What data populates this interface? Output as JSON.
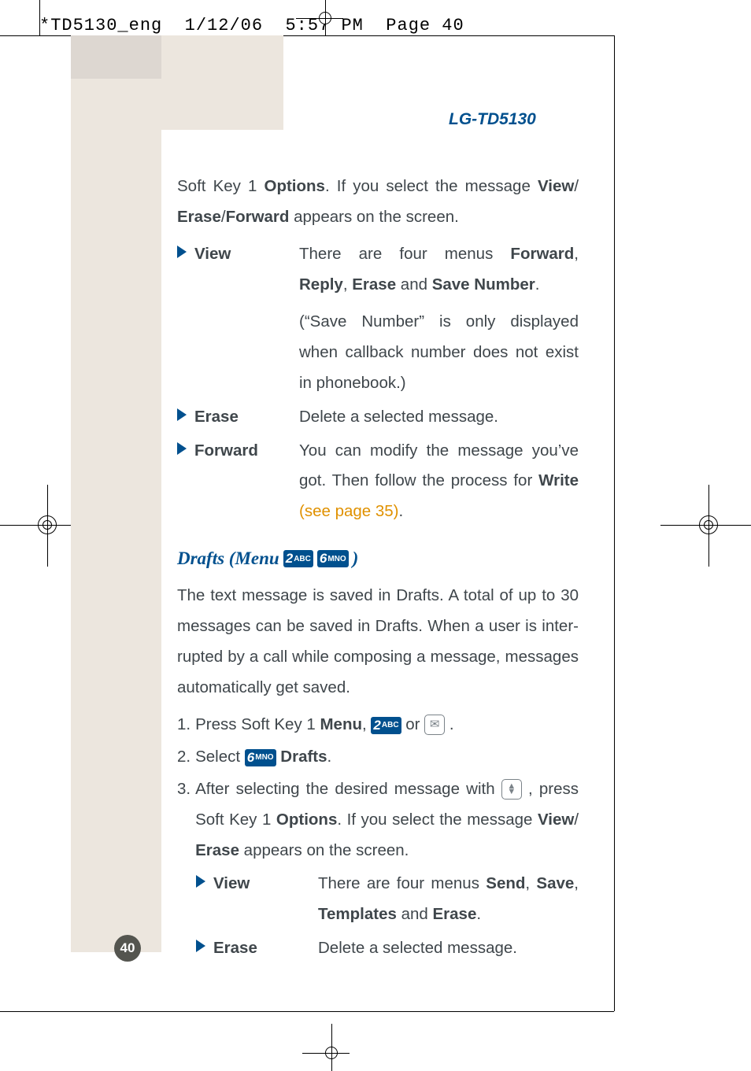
{
  "header": {
    "filename": "*TD5130_eng",
    "date": "1/12/06",
    "time": "5:57 PM",
    "pageLabel": "Page 40"
  },
  "model": "LG-TD5130",
  "intro": {
    "pre": "Soft Key 1 ",
    "options": "Options",
    "mid1": ". If you select the message ",
    "view": "View",
    "slash1": "/",
    "erase": "Erase",
    "slash2": "/",
    "forward": "Forward",
    "post": " appears on the screen."
  },
  "list1": {
    "view": {
      "term": "View",
      "def_pre": "There are four menus ",
      "m1": "Forward",
      "sep1": ", ",
      "m2": "Reply",
      "sep2": ", ",
      "m3": "Erase",
      "sep3": " and ",
      "m4": "Save Number",
      "period": ".",
      "note": "(“Save Number” is only displayed when callback number does not exist in phonebook.)"
    },
    "erase": {
      "term": "Erase",
      "def": "Delete a selected message."
    },
    "forward": {
      "term": "Forward",
      "def_pre": "You can modify the message you’ve got. Then follow the process for ",
      "write": "Write",
      "space": " ",
      "link": "(see page 35)",
      "period": "."
    }
  },
  "section": {
    "title_pre": "Drafts (Menu ",
    "key1_digit": "2",
    "key1_sub": "ABC",
    "key2_digit": "6",
    "key2_sub": "MNO",
    "title_post": " )"
  },
  "drafts_intro": "The text message is saved in Drafts. A total of up to 30 messages can be saved in Drafts.  When a user is inter- rupted by a call while composing a message, messages automatically get saved.",
  "steps": {
    "s1_num": "1.",
    "s1_pre": " Press Soft Key 1 ",
    "s1_menu": "Menu",
    "s1_mid": ", ",
    "s1_key_digit": "2",
    "s1_key_sub": "ABC",
    "s1_or": " or ",
    "s1_end": " .",
    "s2_num": "2.",
    "s2_pre": " Select ",
    "s2_key_digit": "6",
    "s2_key_sub": "MNO",
    "s2_drafts": " Drafts",
    "s2_period": ".",
    "s3_num": "3.",
    "s3_pre": " After selecting the desired message with ",
    "s3_mid": " , press Soft Key 1 ",
    "s3_options": "Options",
    "s3_post": ". If you select the message ",
    "s3_view": "View",
    "s3_slash": "/",
    "s3_erase": "Erase",
    "s3_end": " appears on the screen."
  },
  "list2": {
    "view": {
      "term": "View",
      "def_pre": "There are four menus ",
      "m1": "Send",
      "sep1": ", ",
      "m2": "Save",
      "sep2": ", ",
      "m3": "Templates",
      "sep3": " and ",
      "m4": "Erase",
      "period": "."
    },
    "erase": {
      "term": "Erase",
      "def": "Delete a selected message."
    }
  },
  "pageNumber": "40"
}
